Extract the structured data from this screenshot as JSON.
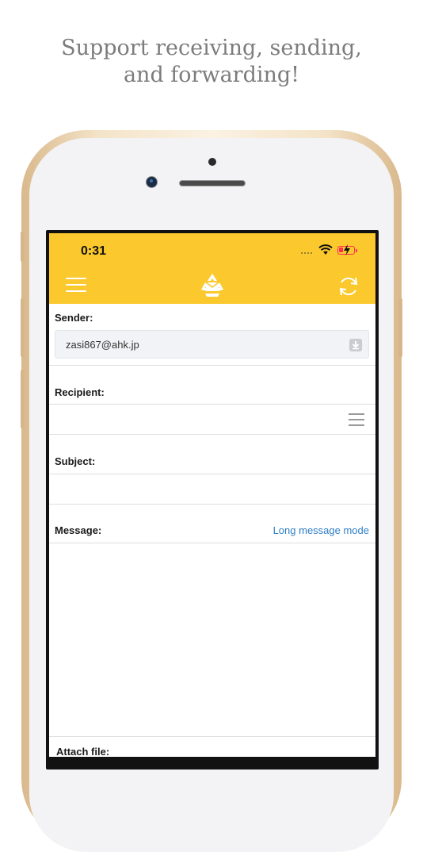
{
  "headline": {
    "line1": "Support receiving, sending,",
    "line2": "and forwarding!"
  },
  "status_bar": {
    "time": "0:31",
    "battery_color": "#ff2d55"
  },
  "app_header": {
    "background": "#fbc92d",
    "left_icon": "menu-icon",
    "center_icon": "recycle-mail-logo-icon",
    "right_icon": "refresh-icon"
  },
  "form": {
    "sender_label": "Sender:",
    "sender_value": "zasi867@ahk.jp",
    "recipient_label": "Recipient:",
    "recipient_value": "",
    "subject_label": "Subject:",
    "subject_value": "",
    "message_label": "Message:",
    "long_message_link": "Long message mode",
    "message_value": "",
    "attach_label": "Attach file:"
  },
  "colors": {
    "accent": "#fbc92d",
    "link": "#2f7ec8",
    "headline_text": "#7c7c7c"
  }
}
